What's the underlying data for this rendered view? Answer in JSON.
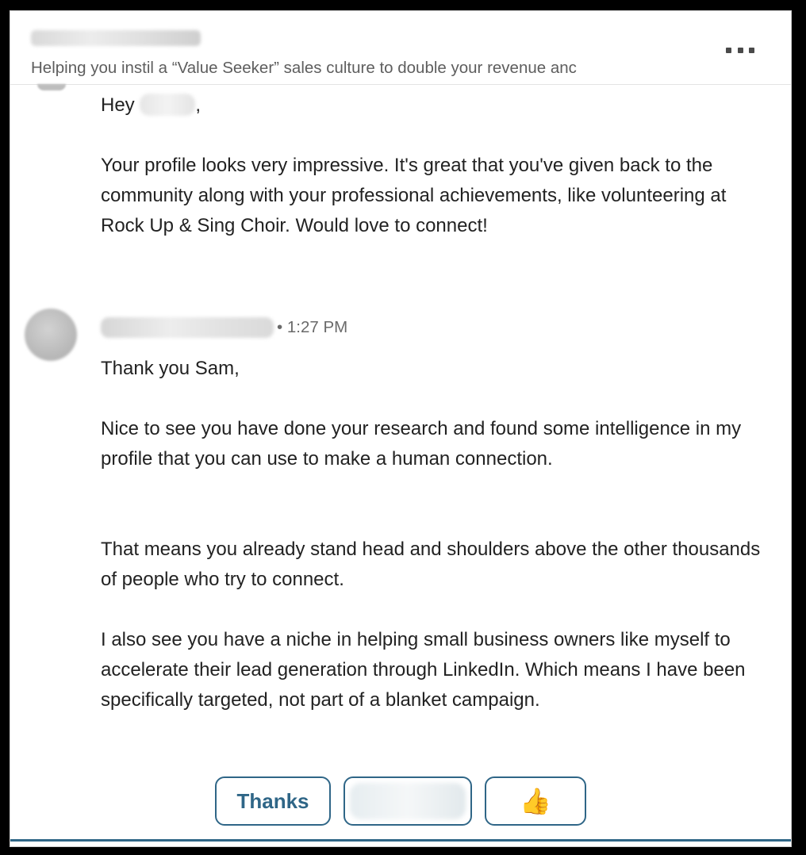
{
  "header": {
    "headline": "Helping you instil a “Value Seeker” sales culture to double your revenue anc",
    "more_icon": "more-horizontal-icon"
  },
  "first_message": {
    "greeting_prefix": "Hey",
    "greeting_suffix": ",",
    "body": "Your profile looks very impressive. It's great that you've given back to the community along with your professional achievements, like volunteering at Rock Up & Sing Choir. Would love to connect!"
  },
  "reply_message": {
    "timestamp": "• 1:27 PM",
    "paragraphs": [
      "Thank you Sam,",
      "Nice to see you have done your research and found some intelligence in my profile that you can use to make a human connection.",
      "That means you already stand head and shoulders above the other thousands of people who try to connect.",
      "I also see you have a niche in helping small business owners like myself to accelerate their lead generation through LinkedIn. Which means I have been specifically targeted, not part of a blanket campaign."
    ]
  },
  "quick_replies": {
    "thanks_label": "Thanks",
    "thumb_icon": "thumbs-up-icon",
    "thumb_glyph": "👍"
  },
  "colors": {
    "accent": "#2f6687",
    "text": "#222222",
    "muted": "#5e5e5e"
  }
}
